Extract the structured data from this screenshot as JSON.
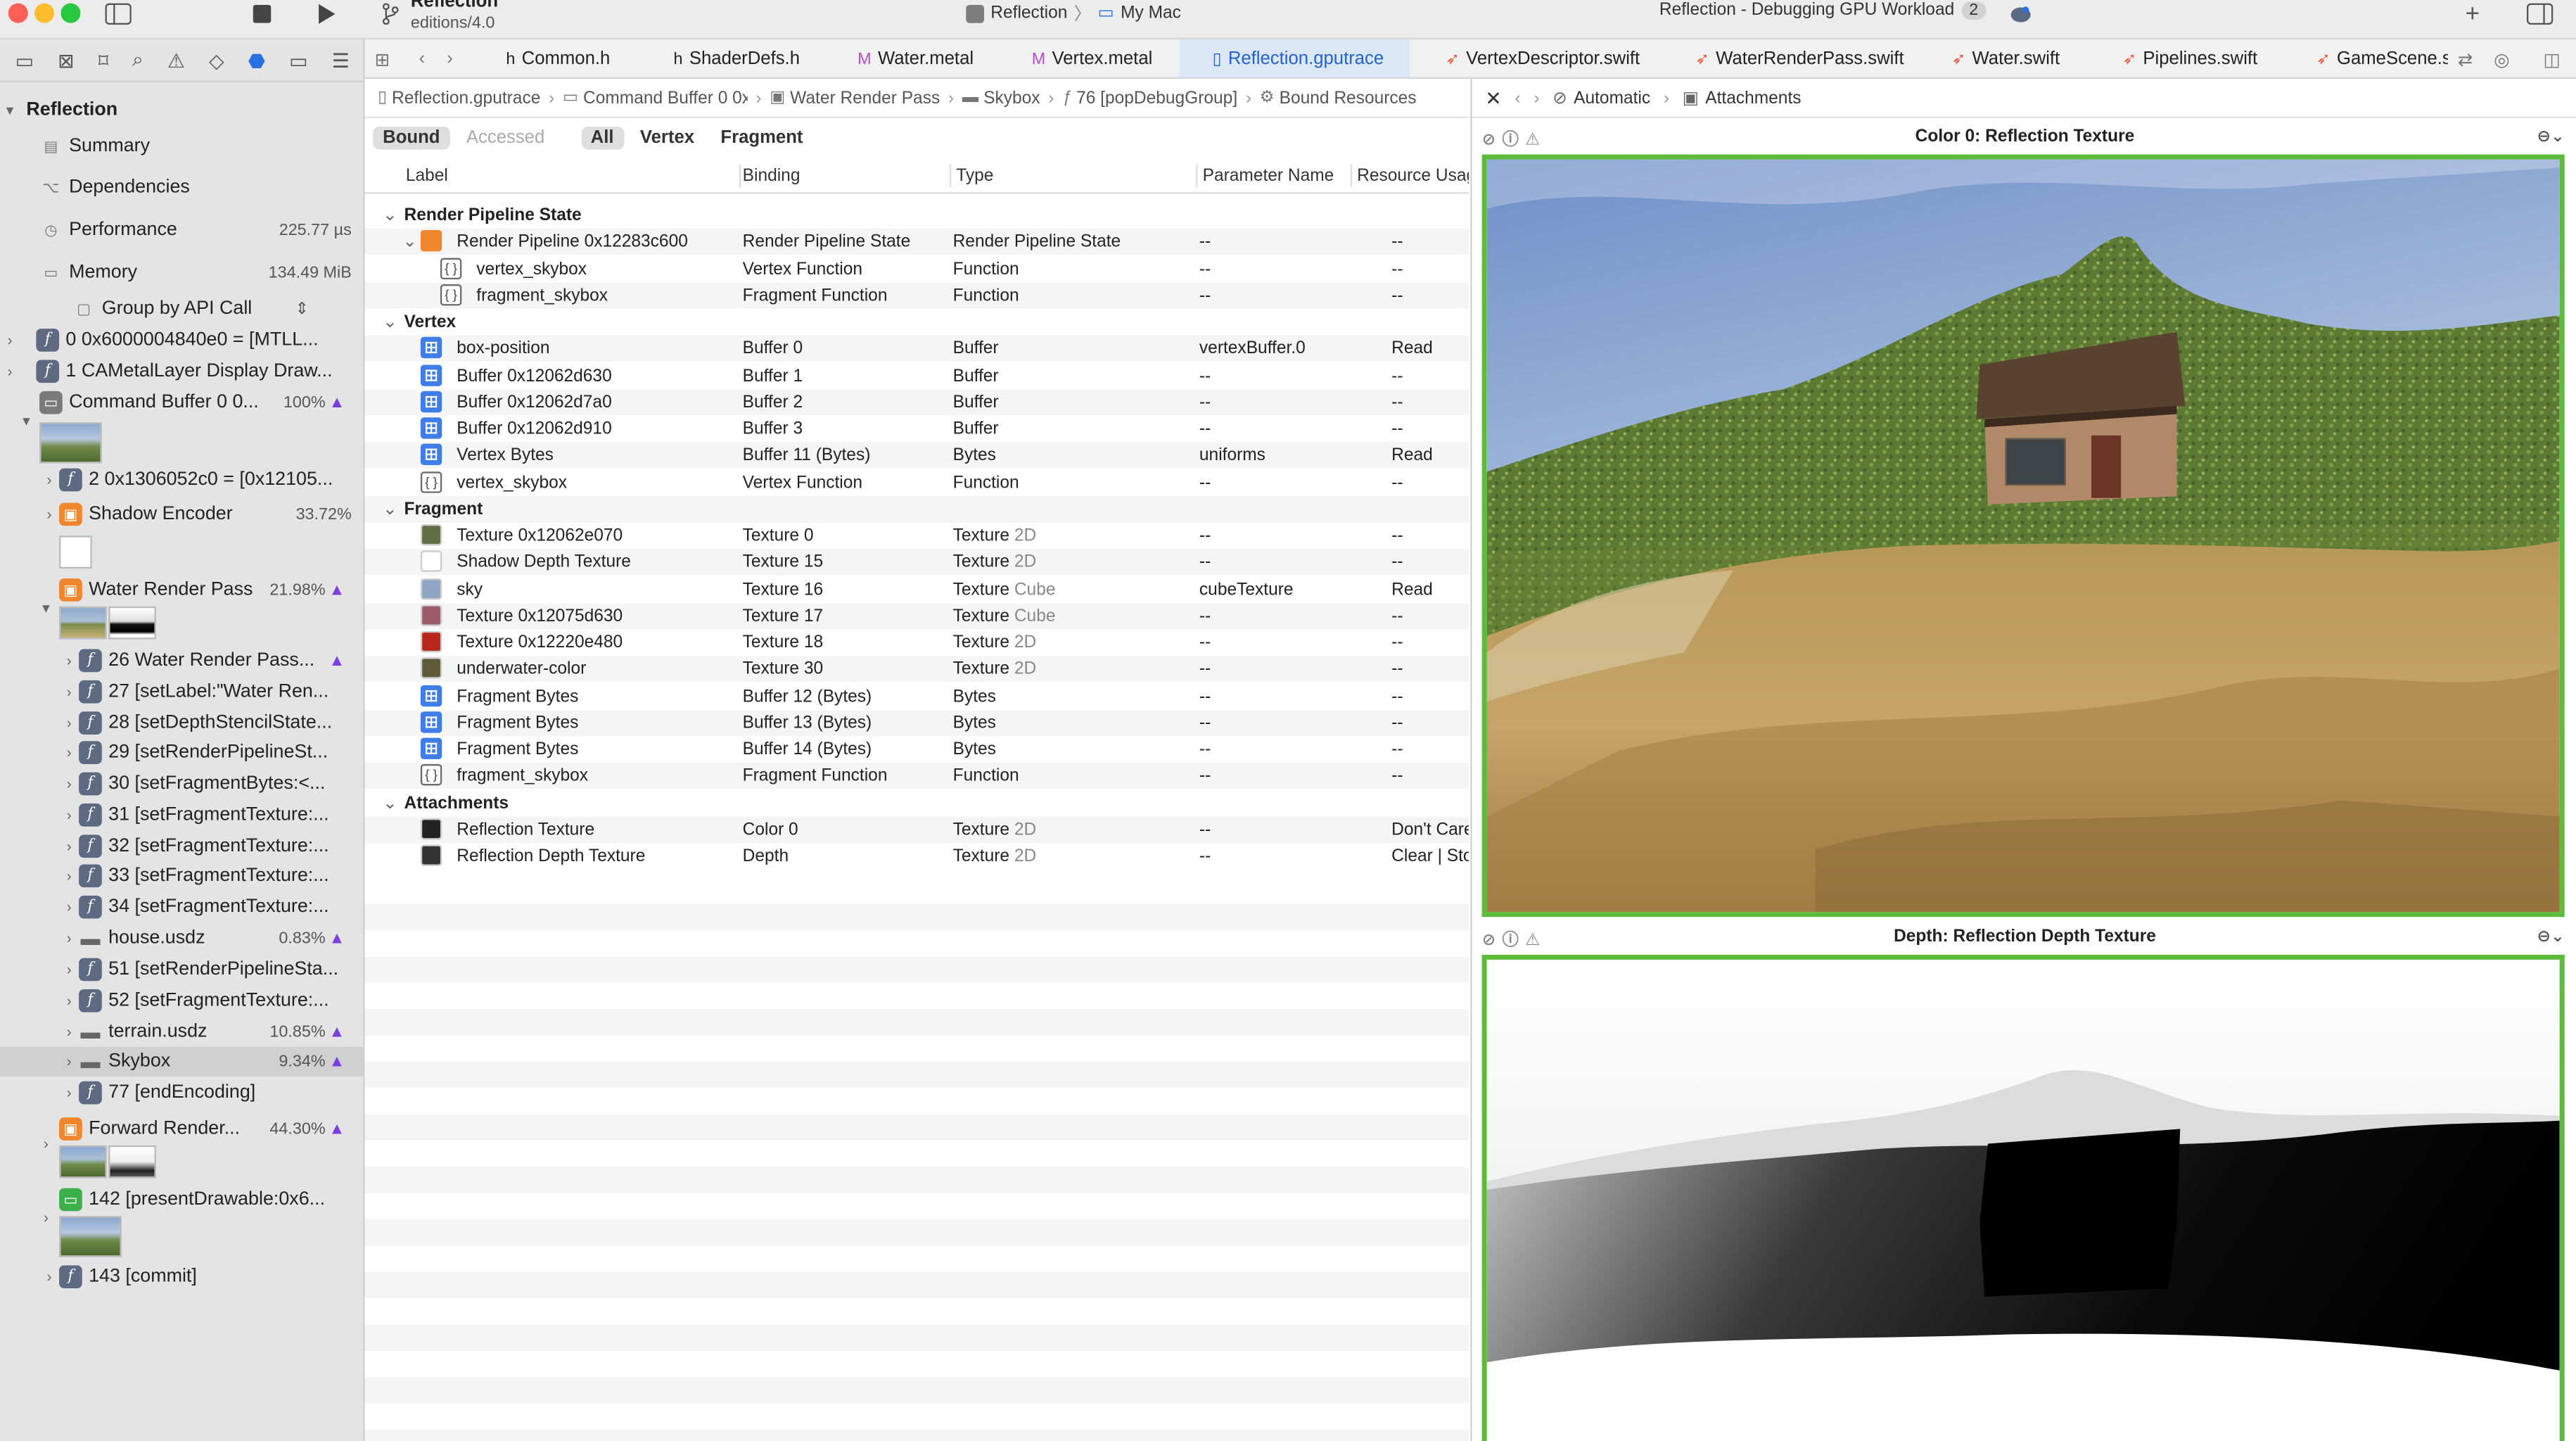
{
  "toolbar": {
    "project_title": "Reflection",
    "project_subtitle": "editions/4.0",
    "scheme": "Reflection",
    "destination": "My Mac",
    "activity": "Reflection - Debugging GPU Workload",
    "activity_badge": "2"
  },
  "tabs": [
    {
      "label": "Common.h",
      "icon": "h"
    },
    {
      "label": "ShaderDefs.h",
      "icon": "h"
    },
    {
      "label": "Water.metal",
      "icon": "M"
    },
    {
      "label": "Vertex.metal",
      "icon": "M"
    },
    {
      "label": "Reflection.gputrace",
      "icon": "doc"
    },
    {
      "label": "VertexDescriptor.swift",
      "icon": "swift"
    },
    {
      "label": "WaterRenderPass.swift",
      "icon": "swift"
    },
    {
      "label": "Water.swift",
      "icon": "swift"
    },
    {
      "label": "Pipelines.swift",
      "icon": "swift"
    },
    {
      "label": "GameScene.sw",
      "icon": "swift"
    }
  ],
  "navigator": {
    "root": "Reflection",
    "summary": "Summary",
    "dependencies": "Dependencies",
    "performance": {
      "label": "Performance",
      "value": "225.77 µs"
    },
    "memory": {
      "label": "Memory",
      "value": "134.49 MiB"
    },
    "group_by": "Group by API Call",
    "items": [
      {
        "label": "0 0x6000004840e0 = [MTLL..."
      },
      {
        "label": "1 CAMetalLayer Display Draw..."
      },
      {
        "label": "Command Buffer 0 0...",
        "value": "100%"
      },
      {
        "label": "2 0x1306052c0 = [0x12105..."
      },
      {
        "label": "Shadow Encoder",
        "value": "33.72%"
      },
      {
        "label": "Water Render Pass",
        "value": "21.98%"
      },
      {
        "label": "26 Water Render Pass..."
      },
      {
        "label": "27 [setLabel:\"Water Ren..."
      },
      {
        "label": "28 [setDepthStencilState..."
      },
      {
        "label": "29 [setRenderPipelineSt..."
      },
      {
        "label": "30 [setFragmentBytes:<..."
      },
      {
        "label": "31 [setFragmentTexture:..."
      },
      {
        "label": "32 [setFragmentTexture:..."
      },
      {
        "label": "33 [setFragmentTexture:..."
      },
      {
        "label": "34 [setFragmentTexture:..."
      },
      {
        "label": "house.usdz",
        "value": "0.83%"
      },
      {
        "label": "51 [setRenderPipelineSta..."
      },
      {
        "label": "52 [setFragmentTexture:..."
      },
      {
        "label": "terrain.usdz",
        "value": "10.85%"
      },
      {
        "label": "Skybox",
        "value": "9.34%"
      },
      {
        "label": "77 [endEncoding]"
      },
      {
        "label": "Forward Render...",
        "value": "44.30%"
      },
      {
        "label": "142 [presentDrawable:0x6..."
      },
      {
        "label": "143 [commit]"
      }
    ]
  },
  "breadcrumb": [
    "Reflection.gputrace",
    "Command Buffer 0 0x",
    "Water Render Pass",
    "Skybox",
    "76 [popDebugGroup]",
    "Bound Resources"
  ],
  "filters": {
    "bound": "Bound",
    "accessed": "Accessed",
    "all": "All",
    "vertex": "Vertex",
    "fragment": "Fragment"
  },
  "table": {
    "columns": [
      "Label",
      "Binding",
      "Type",
      "Parameter Name",
      "Resource Usag"
    ],
    "rows": [
      {
        "kind": "section",
        "label": "Render Pipeline State"
      },
      {
        "kind": "pipe",
        "label": "Render Pipeline 0x12283c600",
        "binding": "Render Pipeline State",
        "type": "Render Pipeline State",
        "param": "--",
        "usage": "--"
      },
      {
        "kind": "fn",
        "label": "vertex_skybox",
        "binding": "Vertex Function",
        "type": "Function",
        "param": "--",
        "usage": "--"
      },
      {
        "kind": "fn",
        "label": "fragment_skybox",
        "binding": "Fragment Function",
        "type": "Function",
        "param": "--",
        "usage": "--"
      },
      {
        "kind": "section",
        "label": "Vertex"
      },
      {
        "kind": "buf",
        "label": "box-position",
        "binding": "Buffer 0",
        "type": "Buffer",
        "param": "vertexBuffer.0",
        "usage": "Read"
      },
      {
        "kind": "buf",
        "label": "Buffer 0x12062d630",
        "binding": "Buffer 1",
        "type": "Buffer",
        "param": "--",
        "usage": "--"
      },
      {
        "kind": "buf",
        "label": "Buffer 0x12062d7a0",
        "binding": "Buffer 2",
        "type": "Buffer",
        "param": "--",
        "usage": "--"
      },
      {
        "kind": "buf",
        "label": "Buffer 0x12062d910",
        "binding": "Buffer 3",
        "type": "Buffer",
        "param": "--",
        "usage": "--"
      },
      {
        "kind": "buf",
        "label": "Vertex Bytes",
        "binding": "Buffer 11 (Bytes)",
        "type": "Bytes",
        "param": "uniforms",
        "usage": "Read"
      },
      {
        "kind": "fn",
        "label": "vertex_skybox",
        "binding": "Vertex Function",
        "type": "Function",
        "param": "--",
        "usage": "--"
      },
      {
        "kind": "section",
        "label": "Fragment"
      },
      {
        "kind": "tex",
        "color": "#5f6e44",
        "label": "Texture 0x12062e070",
        "binding": "Texture 0",
        "type": "Texture",
        "typesub": "2D",
        "param": "--",
        "usage": "--"
      },
      {
        "kind": "tex",
        "color": "#ffffff",
        "label": "Shadow Depth Texture",
        "binding": "Texture 15",
        "type": "Texture",
        "typesub": "2D",
        "param": "--",
        "usage": "--"
      },
      {
        "kind": "tex",
        "color": "#8ea6c4",
        "label": "sky",
        "binding": "Texture 16",
        "type": "Texture",
        "typesub": "Cube",
        "param": "cubeTexture",
        "usage": "Read"
      },
      {
        "kind": "tex",
        "color": "#9c5a6a",
        "label": "Texture 0x12075d630",
        "binding": "Texture 17",
        "type": "Texture",
        "typesub": "Cube",
        "param": "--",
        "usage": "--"
      },
      {
        "kind": "tex",
        "color": "#b8261c",
        "label": "Texture 0x12220e480",
        "binding": "Texture 18",
        "type": "Texture",
        "typesub": "2D",
        "param": "--",
        "usage": "--"
      },
      {
        "kind": "tex",
        "color": "#5f5a3a",
        "label": "underwater-color",
        "binding": "Texture 30",
        "type": "Texture",
        "typesub": "2D",
        "param": "--",
        "usage": "--"
      },
      {
        "kind": "buf",
        "label": "Fragment Bytes",
        "binding": "Buffer 12 (Bytes)",
        "type": "Bytes",
        "param": "--",
        "usage": "--"
      },
      {
        "kind": "buf",
        "label": "Fragment Bytes",
        "binding": "Buffer 13 (Bytes)",
        "type": "Bytes",
        "param": "--",
        "usage": "--"
      },
      {
        "kind": "buf",
        "label": "Fragment Bytes",
        "binding": "Buffer 14 (Bytes)",
        "type": "Bytes",
        "param": "--",
        "usage": "--"
      },
      {
        "kind": "fn",
        "label": "fragment_skybox",
        "binding": "Fragment Function",
        "type": "Function",
        "param": "--",
        "usage": "--"
      },
      {
        "kind": "section",
        "label": "Attachments"
      },
      {
        "kind": "tex",
        "color": "#222222",
        "label": "Reflection Texture",
        "binding": "Color 0",
        "type": "Texture",
        "typesub": "2D",
        "param": "--",
        "usage": "Don't Care"
      },
      {
        "kind": "tex",
        "color": "#333333",
        "label": "Reflection Depth Texture",
        "binding": "Depth",
        "type": "Texture",
        "typesub": "2D",
        "param": "--",
        "usage": "Clear | Sto"
      }
    ]
  },
  "viewer": {
    "mode": "Automatic",
    "section": "Attachments",
    "color_title": "Color 0: Reflection Texture",
    "depth_title": "Depth: Reflection Depth Texture"
  },
  "colors": {
    "accent": "#2463c9",
    "frame": "#5cbc3a",
    "warning": "#7a3fe0"
  }
}
